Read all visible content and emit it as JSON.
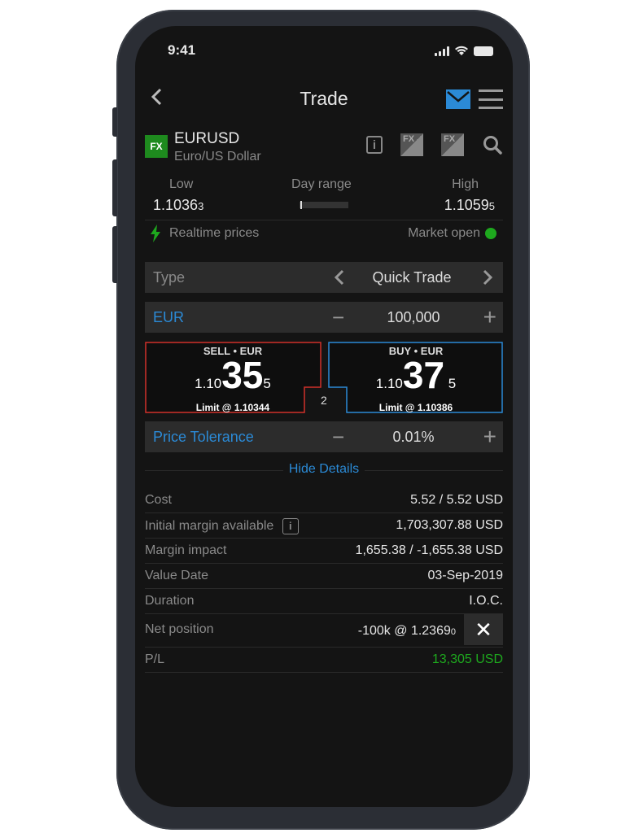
{
  "status_bar": {
    "time": "9:41"
  },
  "header": {
    "back_icon": "chevron-left",
    "title": "Trade",
    "mail_icon": "envelope",
    "menu_icon": "hamburger"
  },
  "instrument": {
    "badge": "FX",
    "symbol": "EURUSD",
    "name": "Euro/US Dollar",
    "icons": [
      "info-icon",
      "fx-forward-icon",
      "fx-option-icon",
      "search-icon"
    ],
    "fx_forward_label": "FX",
    "fx_option_label": "FX",
    "info_glyph": "i"
  },
  "day_range": {
    "low_label": "Low",
    "low_main": "1.1036",
    "low_pip": "3",
    "range_label": "Day range",
    "range_position": 0.02,
    "high_label": "High",
    "high_main": "1.1059",
    "high_pip": "5"
  },
  "feed": {
    "realtime_label": "Realtime prices",
    "market_label": "Market open",
    "market_status_color": "#1ea81e"
  },
  "type_row": {
    "label": "Type",
    "value": "Quick Trade"
  },
  "amount_row": {
    "label": "EUR",
    "value": "100,000",
    "minus": "−",
    "plus": "+"
  },
  "sell": {
    "header": "SELL • EUR",
    "prefix": "1.10",
    "big": "35",
    "pip": "5",
    "limit": "Limit @ 1.10344",
    "color": "#d0302a"
  },
  "buy": {
    "header": "BUY • EUR",
    "prefix": "1.10",
    "big": "37",
    "pip": "5",
    "limit": "Limit @ 1.10386",
    "color": "#2b8ad6"
  },
  "spread": "2",
  "tolerance_row": {
    "label": "Price Tolerance",
    "value": "0.01%",
    "minus": "−",
    "plus": "+"
  },
  "details": {
    "toggle_label": "Hide Details",
    "rows": [
      {
        "label": "Cost",
        "value": "5.52 / 5.52 USD"
      },
      {
        "label": "Initial margin available",
        "value": "1,703,307.88 USD"
      },
      {
        "label": "Margin impact",
        "value": "1,655.38 / -1,655.38 USD"
      },
      {
        "label": "Value Date",
        "value": "03-Sep-2019"
      },
      {
        "label": "Duration",
        "value": "I.O.C."
      },
      {
        "label": "Net position",
        "value_main": "-100k @ 1.2369",
        "value_pip": "0",
        "close_glyph": "✕"
      },
      {
        "label": "P/L",
        "value": "13,305 USD",
        "color": "#1ea81e"
      }
    ]
  }
}
